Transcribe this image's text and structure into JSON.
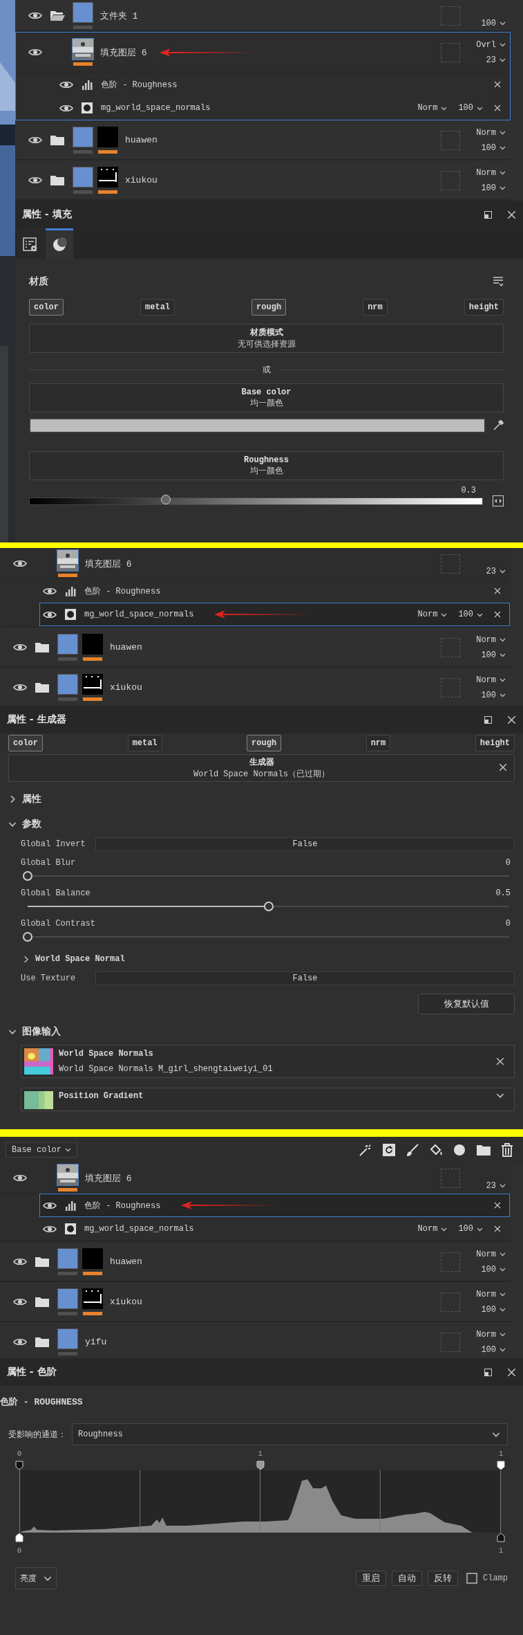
{
  "sections": [
    {
      "viewport": {
        "kind": "picture"
      },
      "layers": [
        {
          "kind": "folder",
          "name": "文件夹 1",
          "expanded": true,
          "opacity": "100",
          "selected": false,
          "pointed": false
        },
        {
          "kind": "fill",
          "name": "填充图层 6",
          "blend": "Ovrl",
          "opacity": "23",
          "selected": true,
          "pointed": true,
          "children": [
            {
              "kind": "levels",
              "name": "色阶 - Roughness",
              "selected": false,
              "pointed": false
            },
            {
              "kind": "generator",
              "name": "mg_world_space_normals",
              "blend": "Norm",
              "opacity": "100",
              "selected": false,
              "pointed": false
            }
          ]
        },
        {
          "kind": "folder",
          "name": "huawen",
          "expanded": false,
          "mask": {
            "marked": false
          },
          "blend": "Norm",
          "opacity": "100",
          "selected": false,
          "pointed": false
        },
        {
          "kind": "folder",
          "name": "xiukou",
          "expanded": false,
          "mask": {
            "marked": true
          },
          "blend": "Norm",
          "opacity": "100",
          "selected": false,
          "pointed": false
        }
      ],
      "properties": {
        "kind": "fill",
        "title": "属性 - 填充",
        "tabs": [
          {
            "selected": false
          },
          {
            "selected": true
          }
        ],
        "heading": "材质",
        "channels": [
          {
            "label": "color",
            "on": true
          },
          {
            "label": "metal",
            "on": false
          },
          {
            "label": "rough",
            "on": true
          },
          {
            "label": "nrm",
            "on": false
          },
          {
            "label": "height",
            "on": false
          }
        ],
        "material_mode": {
          "title": "材质模式",
          "value": "无可供选择资源"
        },
        "or": "或",
        "base_color": {
          "title": "Base color",
          "value": "均一颜色",
          "color": "#bdbdbd"
        },
        "roughness": {
          "title": "Roughness",
          "value": "均一颜色",
          "reading": "0.3",
          "level": 0.3
        }
      }
    },
    {
      "layers": [
        {
          "kind": "fill",
          "name": "填充图层 6",
          "opacity": "23",
          "selected": false,
          "pointed": false,
          "children": [
            {
              "kind": "levels",
              "name": "色阶 - Roughness",
              "selected": false,
              "pointed": false
            },
            {
              "kind": "generator",
              "name": "mg_world_space_normals",
              "blend": "Norm",
              "opacity": "100",
              "selected": true,
              "pointed": true
            }
          ]
        },
        {
          "kind": "folder",
          "name": "huawen",
          "expanded": false,
          "mask": {
            "marked": false
          },
          "blend": "Norm",
          "opacity": "100",
          "selected": false,
          "pointed": false
        },
        {
          "kind": "folder",
          "name": "xiukou",
          "expanded": false,
          "mask": {
            "marked": true
          },
          "blend": "Norm",
          "opacity": "100",
          "selected": false,
          "pointed": false
        }
      ],
      "properties": {
        "kind": "generator",
        "title": "属性 - 生成器",
        "channels": [
          {
            "label": "color",
            "on": true
          },
          {
            "label": "metal",
            "on": false
          },
          {
            "label": "rough",
            "on": true
          },
          {
            "label": "nrm",
            "on": false
          },
          {
            "label": "height",
            "on": false
          }
        ],
        "generator": {
          "title": "生成器",
          "value": "World Space Normals（已过期）"
        },
        "groups": [
          {
            "label": "属性",
            "expanded": false
          },
          {
            "label": "参数",
            "expanded": true,
            "params": [
              {
                "kind": "toggle",
                "label": "Global Invert",
                "value": "False"
              },
              {
                "kind": "slider",
                "label": "Global Blur",
                "reading": "0",
                "level": 0
              },
              {
                "kind": "slider",
                "label": "Global Balance",
                "reading": "0.5",
                "level": 0.5
              },
              {
                "kind": "slider",
                "label": "Global Contrast",
                "reading": "0",
                "level": 0
              },
              {
                "kind": "subgroup",
                "label": "World Space Normal",
                "expanded": false
              },
              {
                "kind": "toggle",
                "label": "Use Texture",
                "value": "False"
              },
              {
                "kind": "button",
                "label": "恢复默认值"
              }
            ]
          },
          {
            "label": "图像输入",
            "expanded": true,
            "inputs": [
              {
                "title": "World Space Normals",
                "detail": "World Space Normals M_girl_shengtaiweiyi_01"
              },
              {
                "title": "Position Gradient"
              }
            ]
          }
        ]
      }
    },
    {
      "toolbar": {
        "channel": "Base color"
      },
      "layers": [
        {
          "kind": "fill",
          "name": "填充图层 6",
          "opacity": "23",
          "selected": false,
          "pointed": false,
          "children": [
            {
              "kind": "levels",
              "name": "色阶 - Roughness",
              "selected": true,
              "pointed": true
            },
            {
              "kind": "generator",
              "name": "mg_world_space_normals",
              "blend": "Norm",
              "opacity": "100",
              "selected": false,
              "pointed": false
            }
          ]
        },
        {
          "kind": "folder",
          "name": "huawen",
          "expanded": false,
          "mask": {
            "marked": false
          },
          "blend": "Norm",
          "opacity": "100",
          "selected": false,
          "pointed": false
        },
        {
          "kind": "folder",
          "name": "xiukou",
          "expanded": false,
          "mask": {
            "marked": true
          },
          "blend": "Norm",
          "opacity": "100",
          "selected": false,
          "pointed": false
        },
        {
          "kind": "folder",
          "name": "yifu",
          "expanded": false,
          "blend": "Norm",
          "opacity": "100",
          "selected": false,
          "pointed": false
        }
      ],
      "properties": {
        "kind": "levels",
        "title": "属性 - 色阶",
        "heading": "色阶 - ROUGHNESS",
        "channel_field": {
          "label": "受影响的通道：",
          "value": "Roughness"
        },
        "input_markers": [
          {
            "label": "0",
            "level": 0
          },
          {
            "label": "1",
            "level": 0.5
          },
          {
            "label": "1",
            "level": 1
          }
        ],
        "output_markers": [
          {
            "label": "0",
            "level": 0
          },
          {
            "label": "1",
            "level": 1
          }
        ],
        "mode": "亮度",
        "buttons": [
          "重启",
          "自动",
          "反转"
        ],
        "clamp": {
          "label": "Clamp",
          "checked": false
        }
      }
    }
  ]
}
